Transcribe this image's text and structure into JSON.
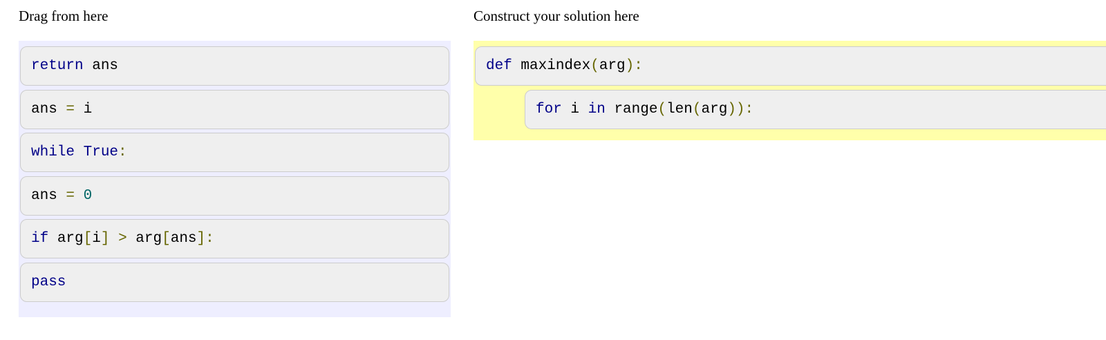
{
  "source": {
    "title": "Drag from here",
    "blocks": [
      {
        "tokens": [
          {
            "t": "return",
            "c": "kw"
          },
          {
            "t": " ans",
            "c": "pln"
          }
        ]
      },
      {
        "tokens": [
          {
            "t": "ans ",
            "c": "pln"
          },
          {
            "t": "=",
            "c": "pun"
          },
          {
            "t": " i",
            "c": "pln"
          }
        ]
      },
      {
        "tokens": [
          {
            "t": "while",
            "c": "kw"
          },
          {
            "t": " ",
            "c": "pln"
          },
          {
            "t": "True",
            "c": "kw"
          },
          {
            "t": ":",
            "c": "pun"
          }
        ]
      },
      {
        "tokens": [
          {
            "t": "ans ",
            "c": "pln"
          },
          {
            "t": "=",
            "c": "pun"
          },
          {
            "t": " ",
            "c": "pln"
          },
          {
            "t": "0",
            "c": "lit"
          }
        ]
      },
      {
        "tokens": [
          {
            "t": "if",
            "c": "kw"
          },
          {
            "t": " arg",
            "c": "pln"
          },
          {
            "t": "[",
            "c": "pun"
          },
          {
            "t": "i",
            "c": "pln"
          },
          {
            "t": "]",
            "c": "pun"
          },
          {
            "t": " ",
            "c": "pln"
          },
          {
            "t": ">",
            "c": "pun"
          },
          {
            "t": " arg",
            "c": "pln"
          },
          {
            "t": "[",
            "c": "pun"
          },
          {
            "t": "ans",
            "c": "pln"
          },
          {
            "t": "]:",
            "c": "pun"
          }
        ]
      },
      {
        "tokens": [
          {
            "t": "pass",
            "c": "kw"
          }
        ]
      }
    ]
  },
  "answer": {
    "title": "Construct your solution here",
    "blocks": [
      {
        "indent": 0,
        "tokens": [
          {
            "t": "def",
            "c": "kw"
          },
          {
            "t": " maxindex",
            "c": "pln"
          },
          {
            "t": "(",
            "c": "pun"
          },
          {
            "t": "arg",
            "c": "pln"
          },
          {
            "t": "):",
            "c": "pun"
          }
        ]
      },
      {
        "indent": 1,
        "tokens": [
          {
            "t": "for",
            "c": "kw"
          },
          {
            "t": " i ",
            "c": "pln"
          },
          {
            "t": "in",
            "c": "kw"
          },
          {
            "t": " range",
            "c": "pln"
          },
          {
            "t": "(",
            "c": "pun"
          },
          {
            "t": "len",
            "c": "pln"
          },
          {
            "t": "(",
            "c": "pun"
          },
          {
            "t": "arg",
            "c": "pln"
          },
          {
            "t": ")):",
            "c": "pun"
          }
        ]
      }
    ]
  },
  "colors": {
    "keyword": "#000088",
    "punctuation": "#666600",
    "literal": "#006666",
    "source_bg": "#eeeeff",
    "answer_bg": "#ffffaa",
    "block_bg": "#efefef"
  }
}
